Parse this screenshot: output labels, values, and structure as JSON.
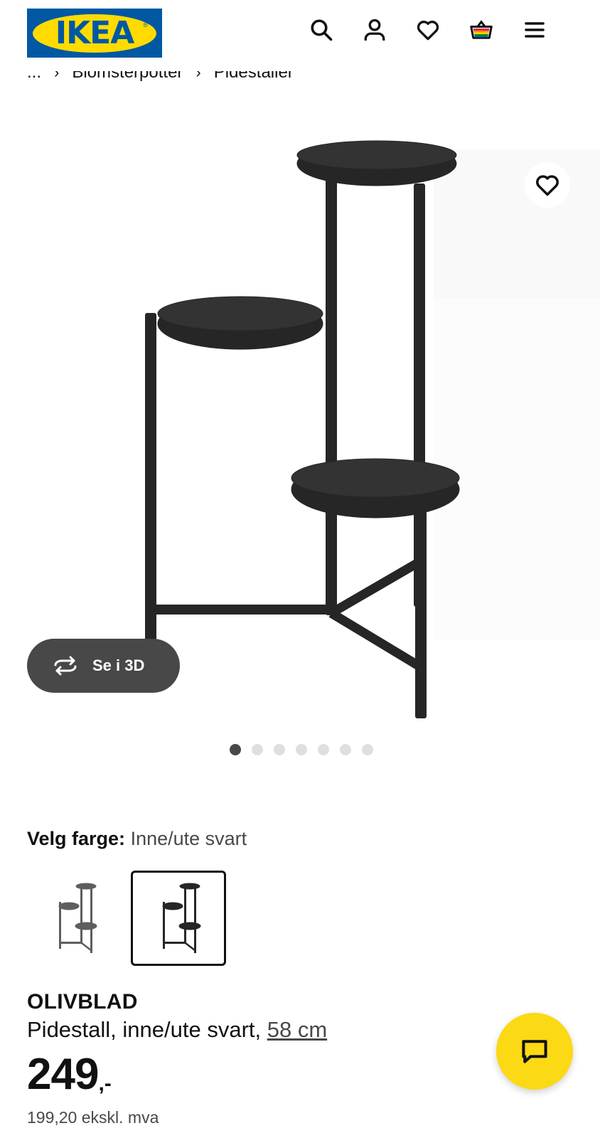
{
  "header": {
    "logo_text": "IKEA",
    "logo_reg": "®",
    "icons": [
      "search-icon",
      "account-icon",
      "heart-icon",
      "basket-icon",
      "menu-icon"
    ]
  },
  "breadcrumb": {
    "ellipsis": "...",
    "items": [
      "Blomsterpotter",
      "Pidestaller"
    ]
  },
  "gallery": {
    "button_3d_label": "Se i 3D",
    "dots_total": 7,
    "dots_active": 1
  },
  "color_select": {
    "label": "Velg farge:",
    "value": "Inne/ute svart",
    "swatches": [
      "Inne/ute grå",
      "Inne/ute svart"
    ],
    "selected_index": 1
  },
  "product": {
    "name": "OLIVBLAD",
    "description": "Pidestall, inne/ute svart, ",
    "size": "58 cm",
    "price_integer": "249",
    "price_suffix": ",-",
    "price_ex_vat": "199,20 ekskl. mva"
  },
  "colors": {
    "brand_blue": "#0058a3",
    "brand_yellow": "#ffdb00",
    "chat_yellow": "#fbd914",
    "button_dark": "#484848"
  }
}
